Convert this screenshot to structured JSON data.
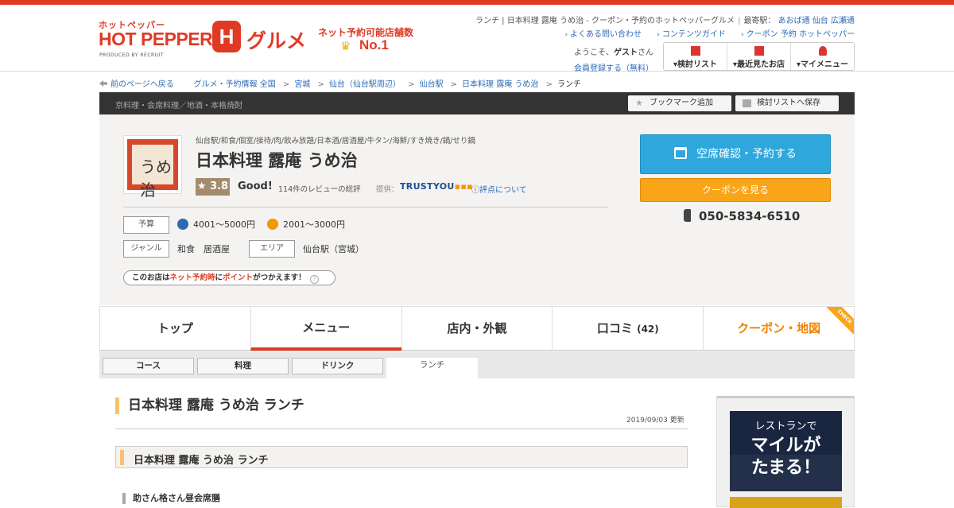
{
  "header": {
    "logo_small": "ホットペッパー",
    "logo_main": "HOT PEPPER",
    "logo_h": "H",
    "logo_gourmet": "グルメ",
    "logo_produced": "PRODUCED BY RECRUIT",
    "no1_text": "ネット予約可能店舗数",
    "no1_rank": "No.1",
    "page_title": "ランチ | 日本料理 露庵 うめ治 - クーポン・予約のホットペッパーグルメ",
    "station_label": "最寄駅：",
    "stations": [
      "あおば通",
      "仙台",
      "広瀬通"
    ],
    "links": [
      "よくある問い合わせ",
      "コンテンツガイド",
      "クーポン 予約 ホットペッパー"
    ],
    "welcome_prefix": "ようこそ、",
    "welcome_name": "ゲスト",
    "welcome_suffix": "さん",
    "register": "会員登録する（無料）",
    "buttons": [
      "検討リスト",
      "最近見たお店",
      "マイメニュー"
    ]
  },
  "breadcrumb": {
    "back": "前のページへ戻る",
    "items": [
      "グルメ・予約情報 全国",
      "宮城",
      "仙台（仙台駅周辺）",
      "仙台駅",
      "日本料理 露庵 うめ治"
    ],
    "current": "ランチ"
  },
  "darkbar": {
    "genre": "京料理・会席料理／地酒・本格焼酎",
    "bookmark": "ブックマーク追加",
    "save": "検討リストへ保存"
  },
  "shop": {
    "logo_text": "うめ治",
    "categories": "仙台駅/和食/個室/接待/肉/飲み放題/日本酒/居酒屋/牛タン/海鮮/すき焼き/鍋/せり鍋",
    "name": "日本料理 露庵 うめ治",
    "rating": "3.8",
    "rating_word": "Good!",
    "reviews": "114件のレビューの総評",
    "provider_label": "提供：",
    "provider": "TRUSTYOU",
    "rating_about": "評点について",
    "budget_label": "予算",
    "budget_dinner": "4001～5000円",
    "budget_lunch": "2001～3000円",
    "genre_label": "ジャンル",
    "genre_value": "和食　居酒屋",
    "area_label": "エリア",
    "area_value": "仙台駅（宮城）",
    "points_pre": "このお店は",
    "points_red1": "ネット予約時",
    "points_mid": "に",
    "points_red2": "ポイント",
    "points_post": "がつかえます！",
    "reserve_btn": "空席確認・予約する",
    "coupon_btn": "クーポンを見る",
    "phone": "050-5834-6510"
  },
  "tabs": [
    {
      "label": "トップ"
    },
    {
      "label": "メニュー",
      "active": true
    },
    {
      "label": "店内・外観"
    },
    {
      "label": "口コミ",
      "count": "(42)"
    },
    {
      "label": "クーポン・地図",
      "ribbon": "CHECK"
    }
  ],
  "subtabs": [
    "コース",
    "料理",
    "ドリンク",
    "ランチ"
  ],
  "content": {
    "title": "日本料理 露庵 うめ治 ランチ",
    "updated": "2019/09/03 更新",
    "section_title": "日本料理 露庵 うめ治 ランチ",
    "subhead": "助さん格さん昼会席膳"
  },
  "sidebar": {
    "ad_line1": "レストランで",
    "ad_line2": "マイルが",
    "ad_line3": "たまる！"
  },
  "colors": {
    "brand_red": "#e13a24",
    "reserve_blue": "#2ea7dd",
    "coupon_orange": "#f9a51a",
    "rating_bg": "#a38c6e",
    "title_accent": "#f7c26a"
  }
}
